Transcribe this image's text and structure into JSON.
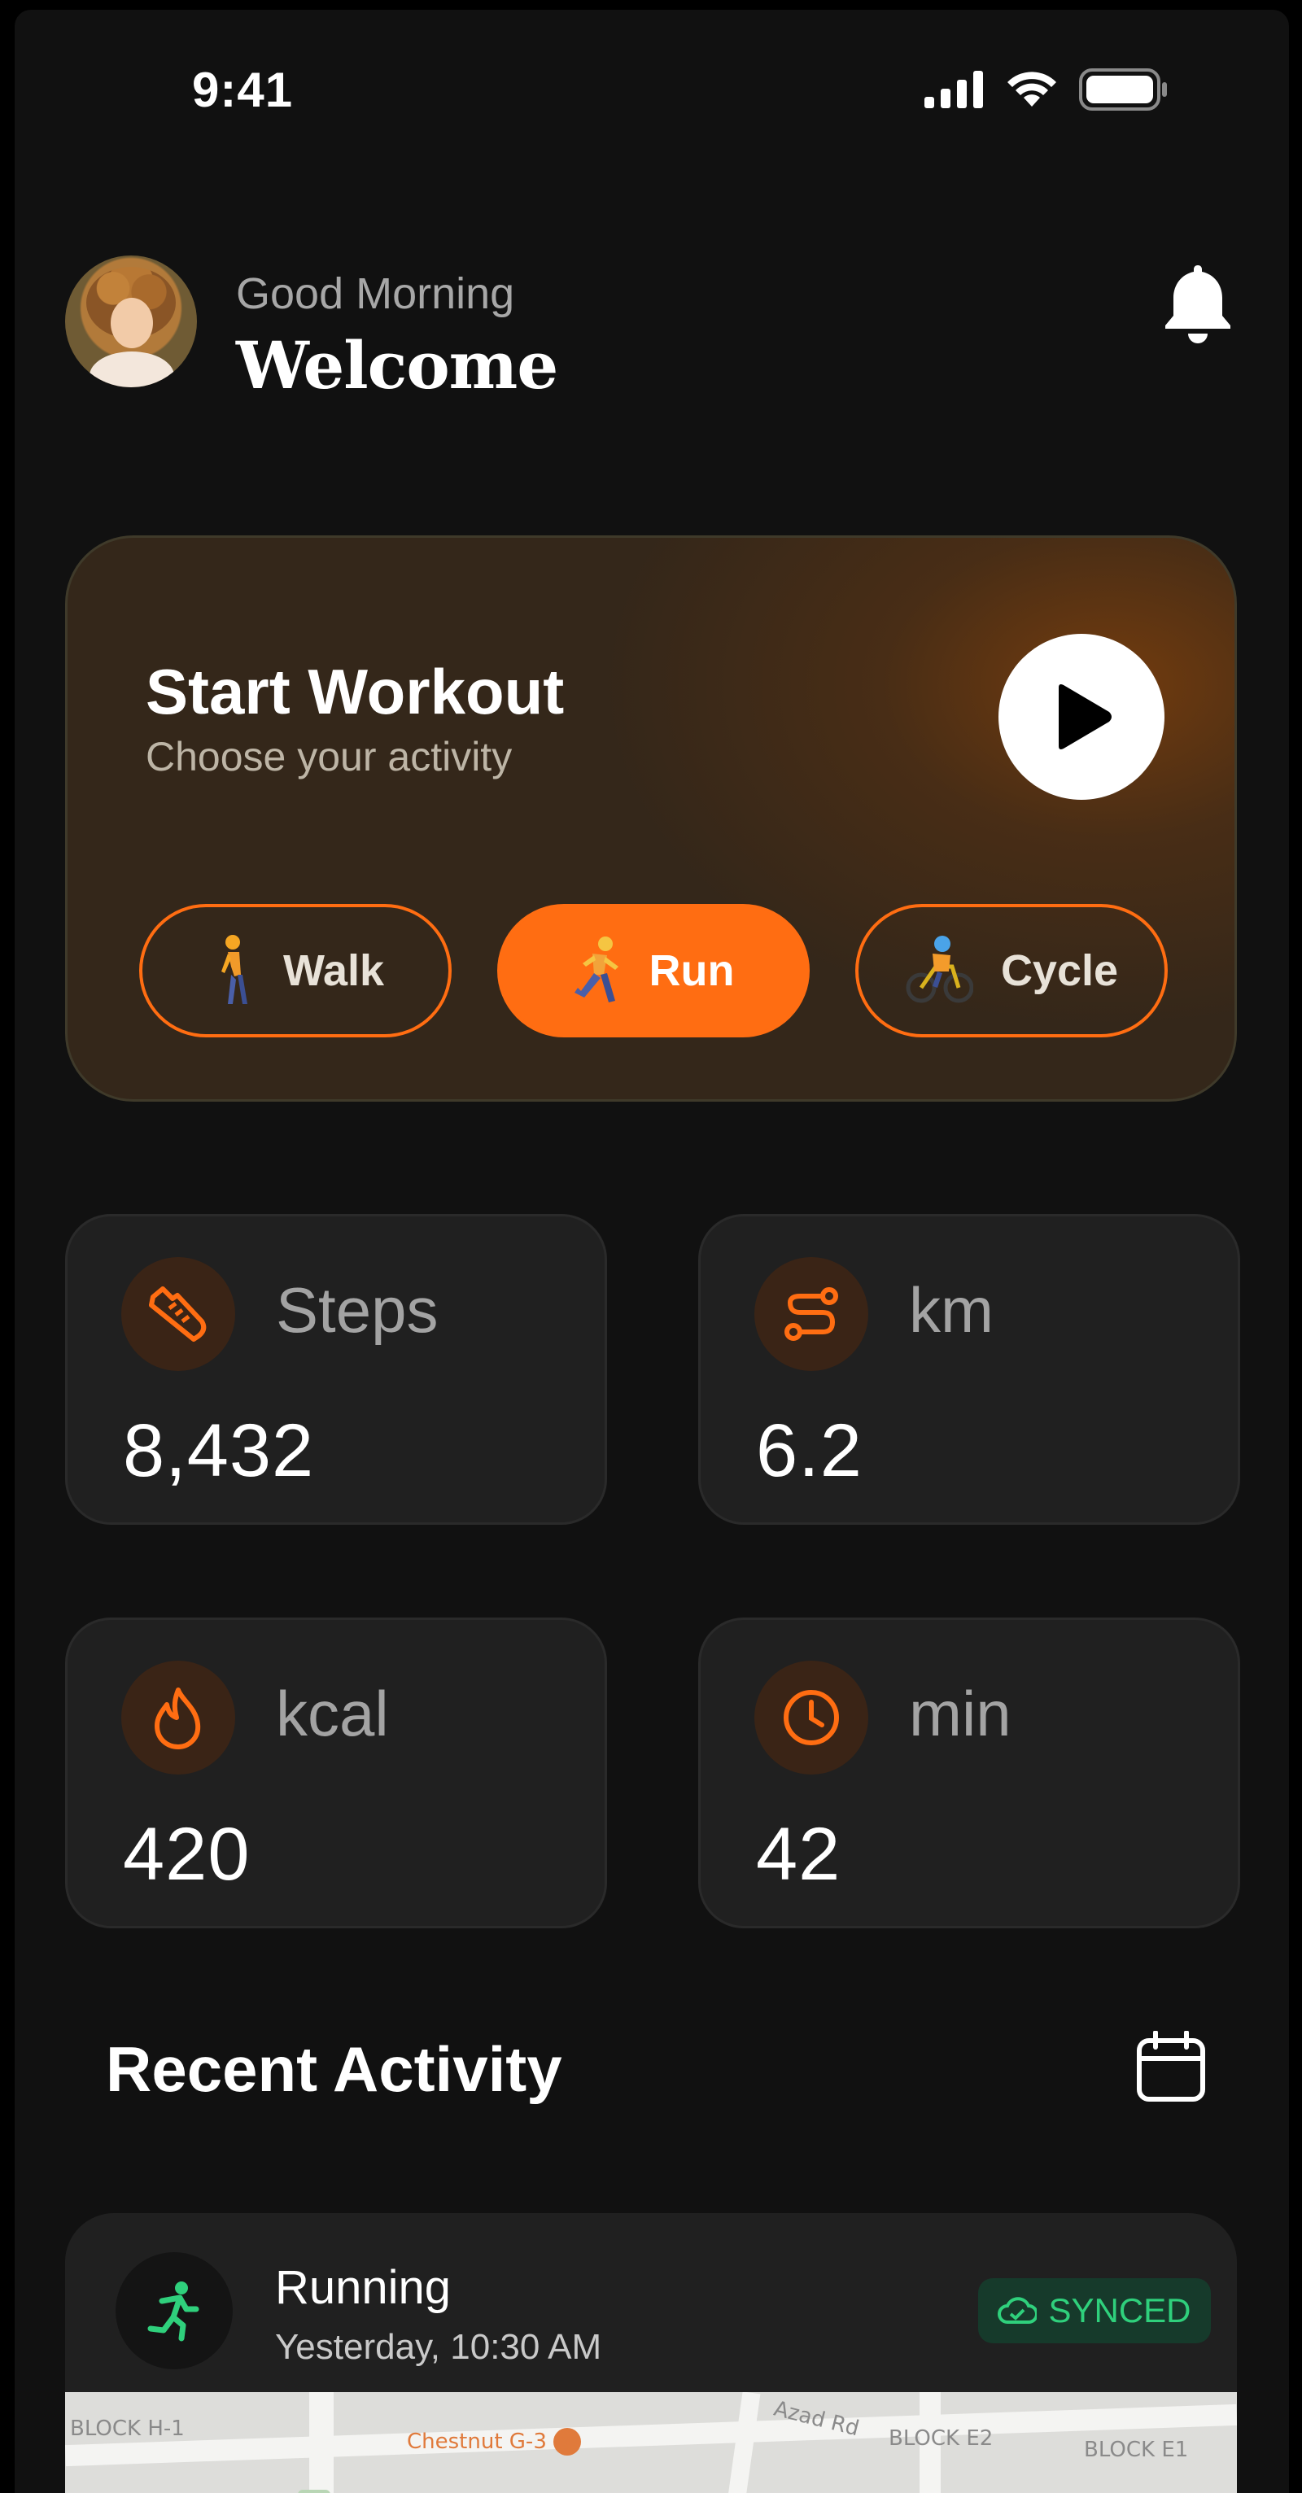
{
  "status_bar": {
    "time": "9:41"
  },
  "header": {
    "greeting": "Good Morning",
    "title": "Welcome"
  },
  "workout": {
    "title": "Start Workout",
    "subtitle": "Choose your activity",
    "activities": [
      {
        "label": "Walk",
        "active": false
      },
      {
        "label": "Run",
        "active": true
      },
      {
        "label": "Cycle",
        "active": false
      }
    ]
  },
  "stats": [
    {
      "label": "Steps",
      "value": "8,432",
      "icon": "shoe-icon"
    },
    {
      "label": "km",
      "value": "6.2",
      "icon": "route-icon"
    },
    {
      "label": "kcal",
      "value": "420",
      "icon": "flame-icon"
    },
    {
      "label": "min",
      "value": "42",
      "icon": "clock-icon"
    }
  ],
  "recent": {
    "title": "Recent Activity",
    "items": [
      {
        "name": "Running",
        "time": "Yesterday, 10:30 AM",
        "status": "SYNCED",
        "map_labels": [
          "BLOCK H-1",
          "Chestnut G-3",
          "BLOCK E2",
          "BLOCK E1",
          "Azad Rd"
        ]
      }
    ]
  },
  "colors": {
    "accent": "#ff6d12",
    "background": "#111111",
    "card": "#202020",
    "synced": "#2fd07c"
  }
}
